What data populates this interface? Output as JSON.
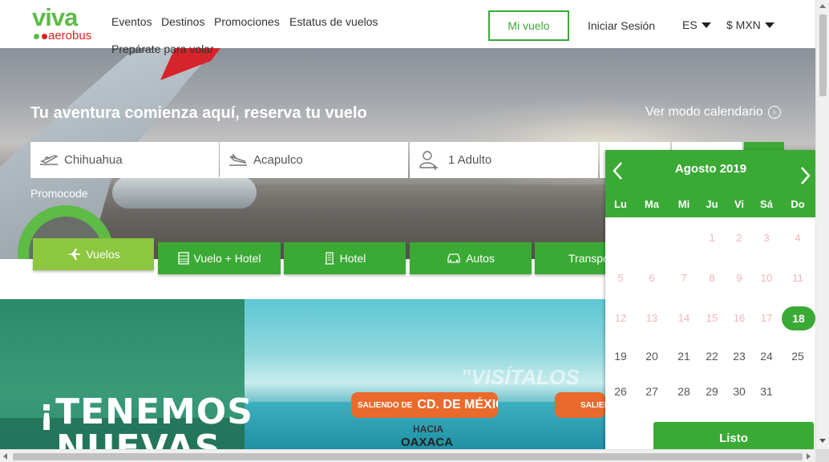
{
  "header": {
    "logo_main": "viva",
    "logo_sub": "aerobus",
    "nav": [
      "Eventos",
      "Destinos",
      "Promociones",
      "Estatus de vuelos",
      "Prepárate para volar"
    ],
    "mi_vuelo": "Mi vuelo",
    "login": "Iniciar Sesión",
    "language": "ES",
    "currency": "$ MXN"
  },
  "hero": {
    "title": "Tu aventura comienza aquí, reserva tu vuelo",
    "calendar_mode": "Ver modo calendario",
    "origin": "Chihuahua",
    "destination": "Acapulco",
    "passengers": "1 Adulto",
    "promocode": "Promocode"
  },
  "tabs": [
    "Vuelos",
    "Vuelo + Hotel",
    "Hotel",
    "Autos",
    "Transportación"
  ],
  "banner": {
    "line1": "¡TENEMOS",
    "line2": "NUEVAS",
    "visit": "\"VISÍTALOS",
    "badge1_small": "SALIENDO DE",
    "badge1_big": "CD. DE MÉXICO",
    "badge2_small": "SALIENDO",
    "hacia": "HACIA",
    "dest": "OAXACA"
  },
  "calendar": {
    "month": "Agosto 2019",
    "weekdays": [
      "Lu",
      "Ma",
      "Mi",
      "Ju",
      "Vi",
      "Sá",
      "Do"
    ],
    "weeks": [
      [
        "",
        "",
        "",
        "1",
        "2",
        "3",
        "4"
      ],
      [
        "5",
        "6",
        "7",
        "8",
        "9",
        "10",
        "11"
      ],
      [
        "12",
        "13",
        "14",
        "15",
        "16",
        "17",
        "18"
      ],
      [
        "19",
        "20",
        "21",
        "22",
        "23",
        "24",
        "25"
      ],
      [
        "26",
        "27",
        "28",
        "29",
        "30",
        "31",
        ""
      ]
    ],
    "selected_day": "18",
    "done": "Listo"
  },
  "colors": {
    "brand_green": "#3aaa35",
    "active_tab": "#8dc63f",
    "accent_red": "#e02020",
    "badge_orange": "#ea6a2c"
  }
}
